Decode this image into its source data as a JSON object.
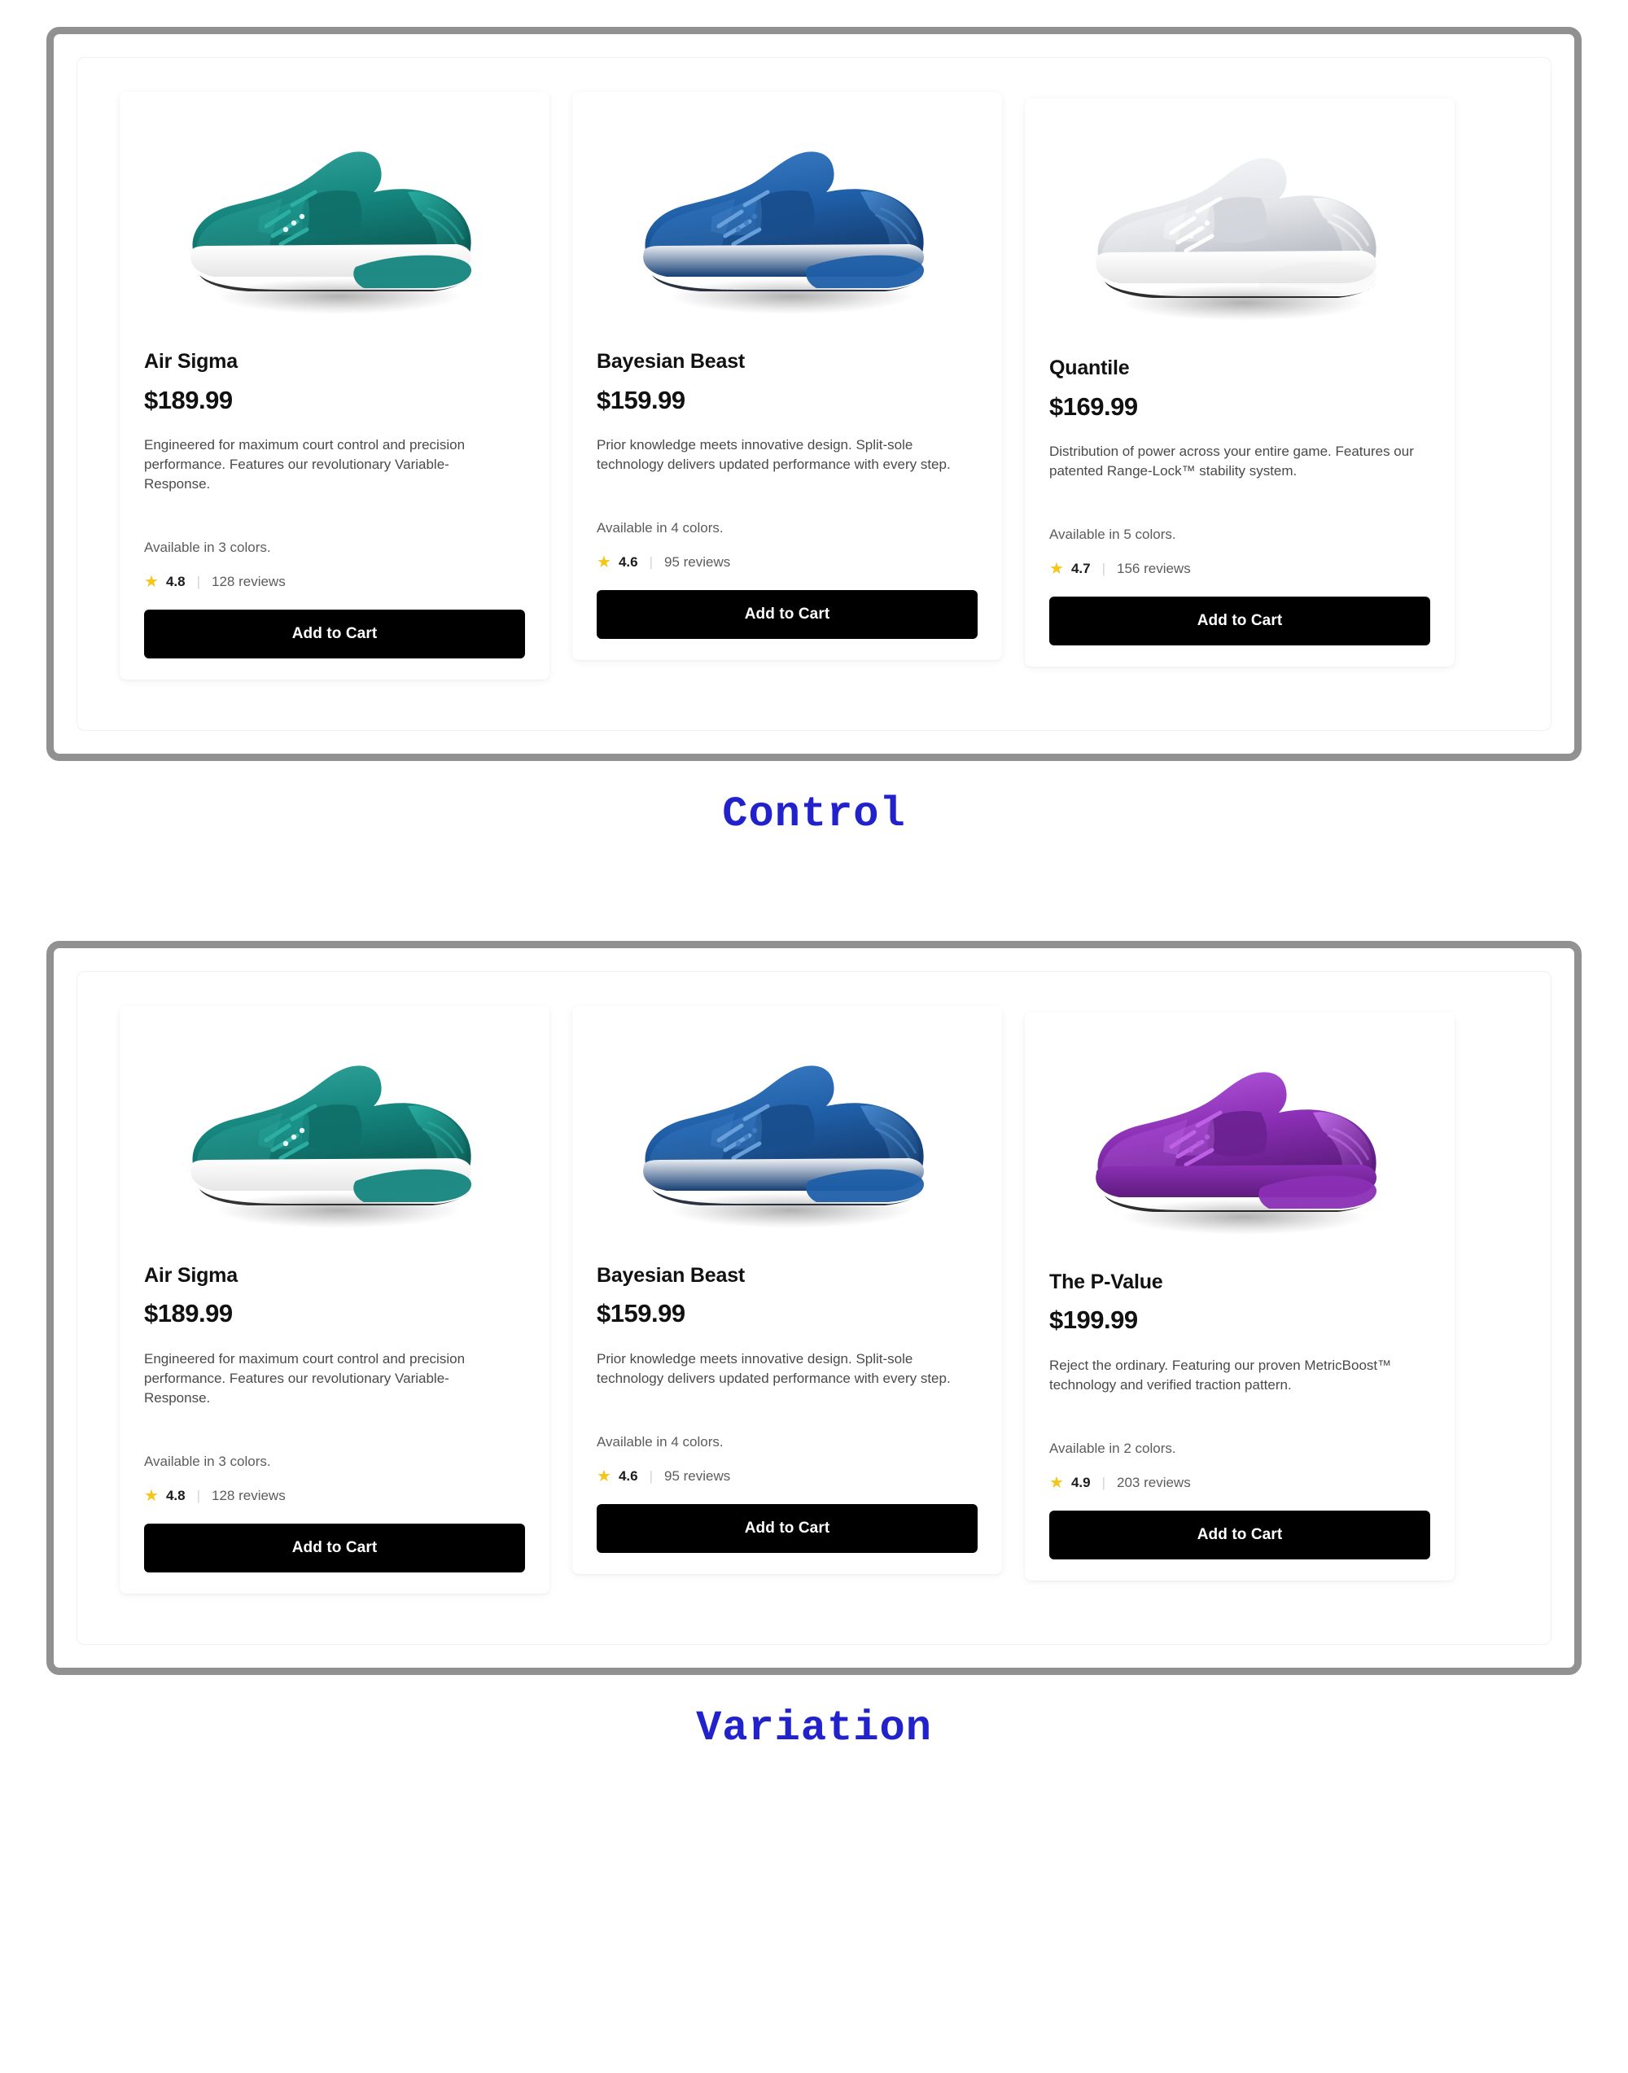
{
  "variants": [
    {
      "caption": "Control",
      "products": [
        {
          "name": "Air Sigma",
          "price": "$189.99",
          "description": "Engineered for maximum court control and precision performance. Features our revolutionary Variable-Response.",
          "colors": "Available in 3 colors.",
          "rating": "4.8",
          "reviews": "128 reviews",
          "cta": "Add to Cart",
          "shoe_color": "teal",
          "shoe_icon": "sneaker-icon"
        },
        {
          "name": "Bayesian Beast",
          "price": "$159.99",
          "description": "Prior knowledge meets innovative design. Split-sole technology delivers updated performance with every step.",
          "colors": "Available in 4 colors.",
          "rating": "4.6",
          "reviews": "95 reviews",
          "cta": "Add to Cart",
          "shoe_color": "blue",
          "shoe_icon": "sneaker-icon"
        },
        {
          "name": "Quantile",
          "price": "$169.99",
          "description": "Distribution of power across your entire game. Features our patented Range-Lock™ stability system.",
          "colors": "Available in 5 colors.",
          "rating": "4.7",
          "reviews": "156 reviews",
          "cta": "Add to Cart",
          "shoe_color": "white",
          "shoe_icon": "sneaker-icon"
        }
      ]
    },
    {
      "caption": "Variation",
      "products": [
        {
          "name": "Air Sigma",
          "price": "$189.99",
          "description": "Engineered for maximum court control and precision performance. Features our revolutionary Variable-Response.",
          "colors": "Available in 3 colors.",
          "rating": "4.8",
          "reviews": "128 reviews",
          "cta": "Add to Cart",
          "shoe_color": "teal",
          "shoe_icon": "sneaker-icon"
        },
        {
          "name": "Bayesian Beast",
          "price": "$159.99",
          "description": "Prior knowledge meets innovative design. Split-sole technology delivers updated performance with every step.",
          "colors": "Available in 4 colors.",
          "rating": "4.6",
          "reviews": "95 reviews",
          "cta": "Add to Cart",
          "shoe_color": "blue",
          "shoe_icon": "sneaker-icon"
        },
        {
          "name": "The P-Value",
          "price": "$199.99",
          "description": "Reject the ordinary. Featuring our proven MetricBoost™ technology and verified traction pattern.",
          "colors": "Available in 2 colors.",
          "rating": "4.9",
          "reviews": "203 reviews",
          "cta": "Add to Cart",
          "shoe_color": "purple",
          "shoe_icon": "sneaker-icon"
        }
      ]
    }
  ],
  "star_glyph": "★",
  "separator_glyph": "|",
  "colors": {
    "frame_border": "#919191",
    "caption_text": "#2222cc",
    "button_bg": "#000000",
    "star": "#f5c518",
    "shoe_teal": "#14857d",
    "shoe_blue": "#1f5fa8",
    "shoe_white": "#d8dade",
    "shoe_purple": "#8b2fb5"
  }
}
